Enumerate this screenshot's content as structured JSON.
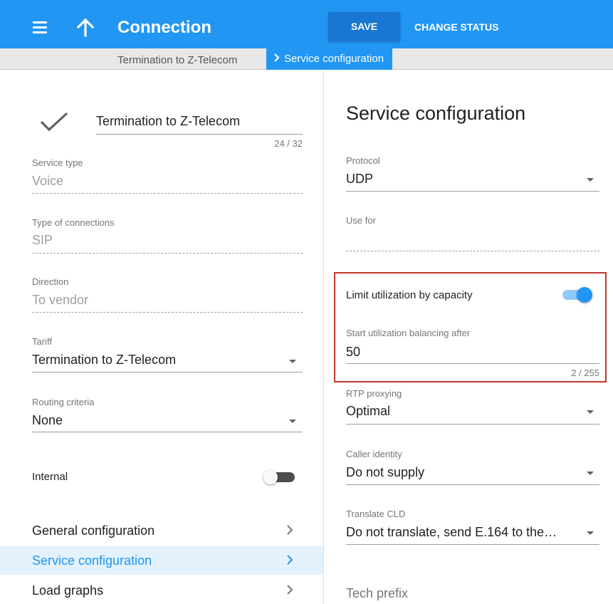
{
  "appbar": {
    "title": "Connection",
    "save_label": "SAVE",
    "change_status_label": "CHANGE STATUS",
    "menu_icon": "hamburger-menu-icon",
    "up_icon": "arrow-up-icon"
  },
  "breadcrumb": {
    "previous": "Termination to Z-Telecom",
    "current": "Service configuration",
    "separator_icon": "chevron-right-icon"
  },
  "left": {
    "name_value": "Termination to Z-Telecom",
    "name_counter": "24 / 32",
    "service_type": {
      "label": "Service type",
      "value": "Voice"
    },
    "connection_type": {
      "label": "Type of connections",
      "value": "SIP"
    },
    "direction": {
      "label": "Direction",
      "value": "To vendor"
    },
    "tariff": {
      "label": "Tariff",
      "value": "Termination to Z-Telecom"
    },
    "routing": {
      "label": "Routing criteria",
      "value": "None"
    },
    "internal": {
      "label": "Internal",
      "enabled": false
    },
    "nav": [
      {
        "label": "General configuration",
        "active": false
      },
      {
        "label": "Service configuration",
        "active": true
      },
      {
        "label": "Load graphs",
        "active": false
      }
    ]
  },
  "right": {
    "title": "Service configuration",
    "protocol": {
      "label": "Protocol",
      "value": "UDP"
    },
    "use_for": {
      "label": "Use for",
      "value": ""
    },
    "limit_util": {
      "label": "Limit utilization by capacity",
      "enabled": true
    },
    "start_util": {
      "label": "Start utilization balancing after",
      "value": "50",
      "counter": "2 / 255"
    },
    "rtp": {
      "label": "RTP proxying",
      "value": "Optimal"
    },
    "caller_identity": {
      "label": "Caller identity",
      "value": "Do not supply"
    },
    "translate_cld": {
      "label": "Translate CLD",
      "value": "Do not translate, send E.164 to the…"
    },
    "tech_prefix": {
      "label": "Tech prefix"
    }
  },
  "colors": {
    "primary": "#2196f3",
    "primary_dark": "#1976d2",
    "highlight_border": "#c0392b",
    "active_nav_bg": "#e3f2fd"
  }
}
